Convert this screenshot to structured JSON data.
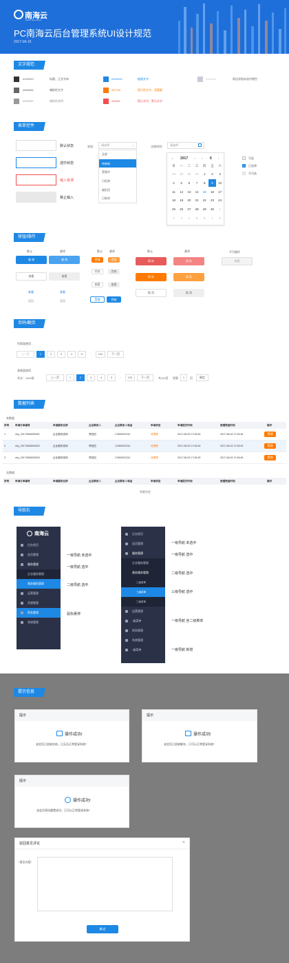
{
  "header": {
    "logo": "南海云",
    "logo_sub": "South Sea Cloud",
    "title": "PC南海云后台管理系统UI设计规范",
    "date": "2017-06-15"
  },
  "sections": {
    "text": "文字规范",
    "form": "表单控件",
    "buttons": "按钮/操作",
    "pager": "页码/翻页",
    "table": "数据列表",
    "nav": "导航栏",
    "tips": "提示信息"
  },
  "colors": [
    {
      "hex": "#333333",
      "code": "#333333",
      "desc": "标题、正文字体"
    },
    {
      "hex": "#666666",
      "code": "#666666",
      "desc": "辅助性文字"
    },
    {
      "hex": "#999999",
      "code": "#999999",
      "desc": "辅助性说明"
    },
    {
      "hex": "#1e88e5",
      "code": "#333333",
      "desc": "链接文字",
      "desc_color": "#1e88e5"
    },
    {
      "hex": "#ff7a00",
      "code": "#ff7200",
      "desc": "提示性文字，双重要",
      "desc_color": "#ff7a00"
    },
    {
      "hex": "#ef4f4f",
      "code": "#ef4f4f",
      "desc": "提示文字，警示文字",
      "desc_color": "#ef4f4f"
    },
    {
      "hex": "#c8cbd3",
      "code": "#c8cbd3",
      "desc": "侧边导航未选中颜色"
    }
  ],
  "form": {
    "default": "默认状态",
    "checked": "选中状态",
    "error": "输入有误",
    "disabled": "禁止输入",
    "status_label": "状态：",
    "status_placeholder": "请选择",
    "status_options": [
      "全部",
      "待审核",
      "受理中",
      "已拒绝",
      "被拒回",
      "已取消"
    ],
    "date_label": "注册时间：",
    "date_placeholder": "请选择",
    "cal_year": "2017",
    "cal_month": "6",
    "weekdays": [
      "日",
      "一",
      "二",
      "三",
      "四",
      "五",
      "六"
    ],
    "days": [
      [
        "28",
        "29",
        "30",
        "31",
        "1",
        "2",
        "3"
      ],
      [
        "4",
        "5",
        "6",
        "7",
        "8",
        "9",
        "10"
      ],
      [
        "11",
        "12",
        "13",
        "14",
        "15",
        "16",
        "17"
      ],
      [
        "18",
        "19",
        "20",
        "21",
        "22",
        "23",
        "24"
      ],
      [
        "25",
        "26",
        "27",
        "28",
        "29",
        "30",
        "1"
      ],
      [
        "2",
        "3",
        "4",
        "5",
        "6",
        "7",
        "8"
      ]
    ],
    "chk_available": "可选",
    "chk_selected": "已选择",
    "chk_unavailable": "不可选"
  },
  "buttons": {
    "default": "默认",
    "hover": "悬停",
    "unavailable": "不可操作",
    "query": "查 询",
    "view": "查看",
    "save": "保 存",
    "cancel": "取 消",
    "small": {
      "a": "受理",
      "b": "完结",
      "c": "查看",
      "d": "受理",
      "e": "查看"
    },
    "tab_a": "受理",
    "tab_b": "完结",
    "link_a": "查看",
    "link_b": "驳回"
  },
  "pager": {
    "list_label": "列表类使用",
    "table_label": "表格类使用",
    "prev": "上一页",
    "next": "下一页",
    "pages": [
      "1",
      "2",
      "3",
      "4",
      "5"
    ],
    "ellipsis": "···",
    "last": "100",
    "total": "共计：1000条",
    "total_pages": "共100页",
    "goto": "到第",
    "page_unit": "页",
    "confirm": "确定",
    "goto_val": "1"
  },
  "table": {
    "has_data": "有数据",
    "no_data": "无数据",
    "empty": "列表为空",
    "headers": [
      "序号",
      "申请订单编号",
      "申请服务名称",
      "企业联系人",
      "企业联系人电话",
      "申请状态",
      "申请提交时间",
      "受理完结时间",
      "操作"
    ],
    "rows": [
      [
        "1",
        "nhy_20170606000001",
        "企业服务咨询",
        "李四四",
        "17600001234",
        "待受理",
        "2017-06-03 17:45:45",
        "2017-06-04 17:45:45",
        "受理"
      ],
      [
        "2",
        "nhy_20170606000002",
        "企业服务咨询",
        "李四四",
        "17600001234",
        "待受理",
        "2017-06-03 17:45:45",
        "2017-06-04 17:45:45",
        "受理"
      ],
      [
        "3",
        "nhy_20170606000003",
        "企业服务咨询",
        "李四四",
        "17600001234",
        "待受理",
        "2017-06-03 17:45:45",
        "2017-06-04 17:45:45",
        "受理"
      ]
    ]
  },
  "nav": {
    "logo": "南海云",
    "left_items": [
      "后台首页",
      "会员管理",
      "服务管理",
      "企业服务管理",
      "政务服务管理",
      "运营管理",
      "资源管理",
      "财务管理",
      "系统管理"
    ],
    "right_items": [
      "后台首页",
      "会员管理",
      "服务管理",
      "企业服务管理",
      "政务服务管理",
      "三级菜单",
      "三级菜单",
      "三级菜单",
      "运营管理",
      "-级菜单",
      "财务管理",
      "系统管理",
      "-级菜单"
    ],
    "ann": [
      "一级导航 未选中",
      "一级导航 选中",
      "二级导航 选中",
      "鼠标悬停",
      "一级导航 未选中",
      "一级导航 选中",
      "二级导航 选中",
      "三级导航 选中",
      "一级导航 含二级菜单",
      "一级导航  新增"
    ]
  },
  "tips": {
    "title": "提示",
    "success": "操作成功!",
    "msg1": "该会员已经被冻结，已无法正常登录系统！",
    "msg2": "该会员已经被解冻，已可以正常登录系统！",
    "msg3": "该会员密码重置成功，已可以正常登录系统！",
    "dialog_title": "驳回意见评论",
    "dialog_label": "* 意见内容：",
    "dialog_confirm": "确 定"
  }
}
